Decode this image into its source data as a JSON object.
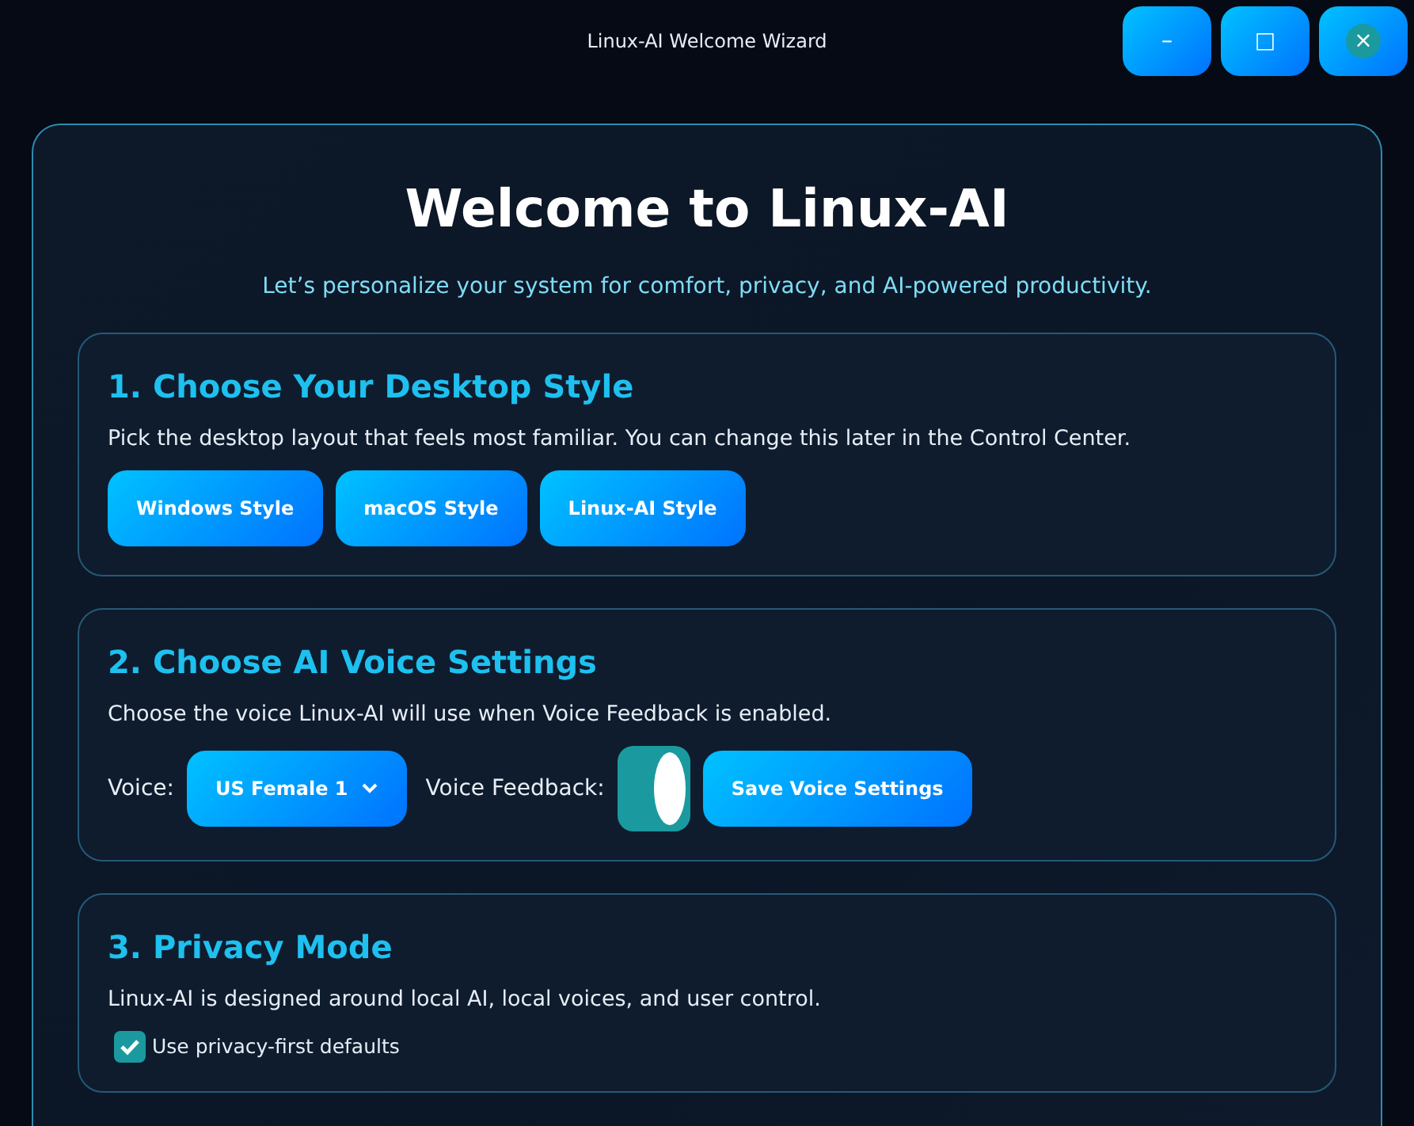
{
  "window": {
    "title": "Linux-AI Welcome Wizard",
    "controls": [
      {
        "kind": "minimize",
        "label": "–"
      },
      {
        "kind": "maximize",
        "label": "□"
      },
      {
        "kind": "close",
        "label": "×"
      }
    ]
  },
  "heading": "Welcome to Linux-AI",
  "subtitle": "Let’s personalize your system for comfort, privacy, and AI-powered productivity.",
  "sections": [
    {
      "kind": "desktop",
      "title": "1. Choose Your Desktop Style",
      "description": "Pick the desktop layout that feels most familiar. You can change this later in the Control Center.",
      "buttons": [
        "Windows Style",
        "macOS Style",
        "Linux-AI Style"
      ]
    },
    {
      "kind": "voice",
      "title": "2. Choose AI Voice Settings",
      "description": "Choose the voice Linux-AI will use when Voice Feedback is enabled.",
      "voice_label": "Voice:",
      "voice_value": "US Female 1",
      "feedback_label": "Voice Feedback:",
      "feedback_on": true,
      "save_button": "Save Voice Settings"
    },
    {
      "kind": "privacy",
      "title": "3. Privacy Mode",
      "description": "Linux-AI is designed around local AI, local voices, and user control.",
      "checkbox": {
        "label": "Use privacy-first defaults",
        "checked": true
      }
    }
  ]
}
